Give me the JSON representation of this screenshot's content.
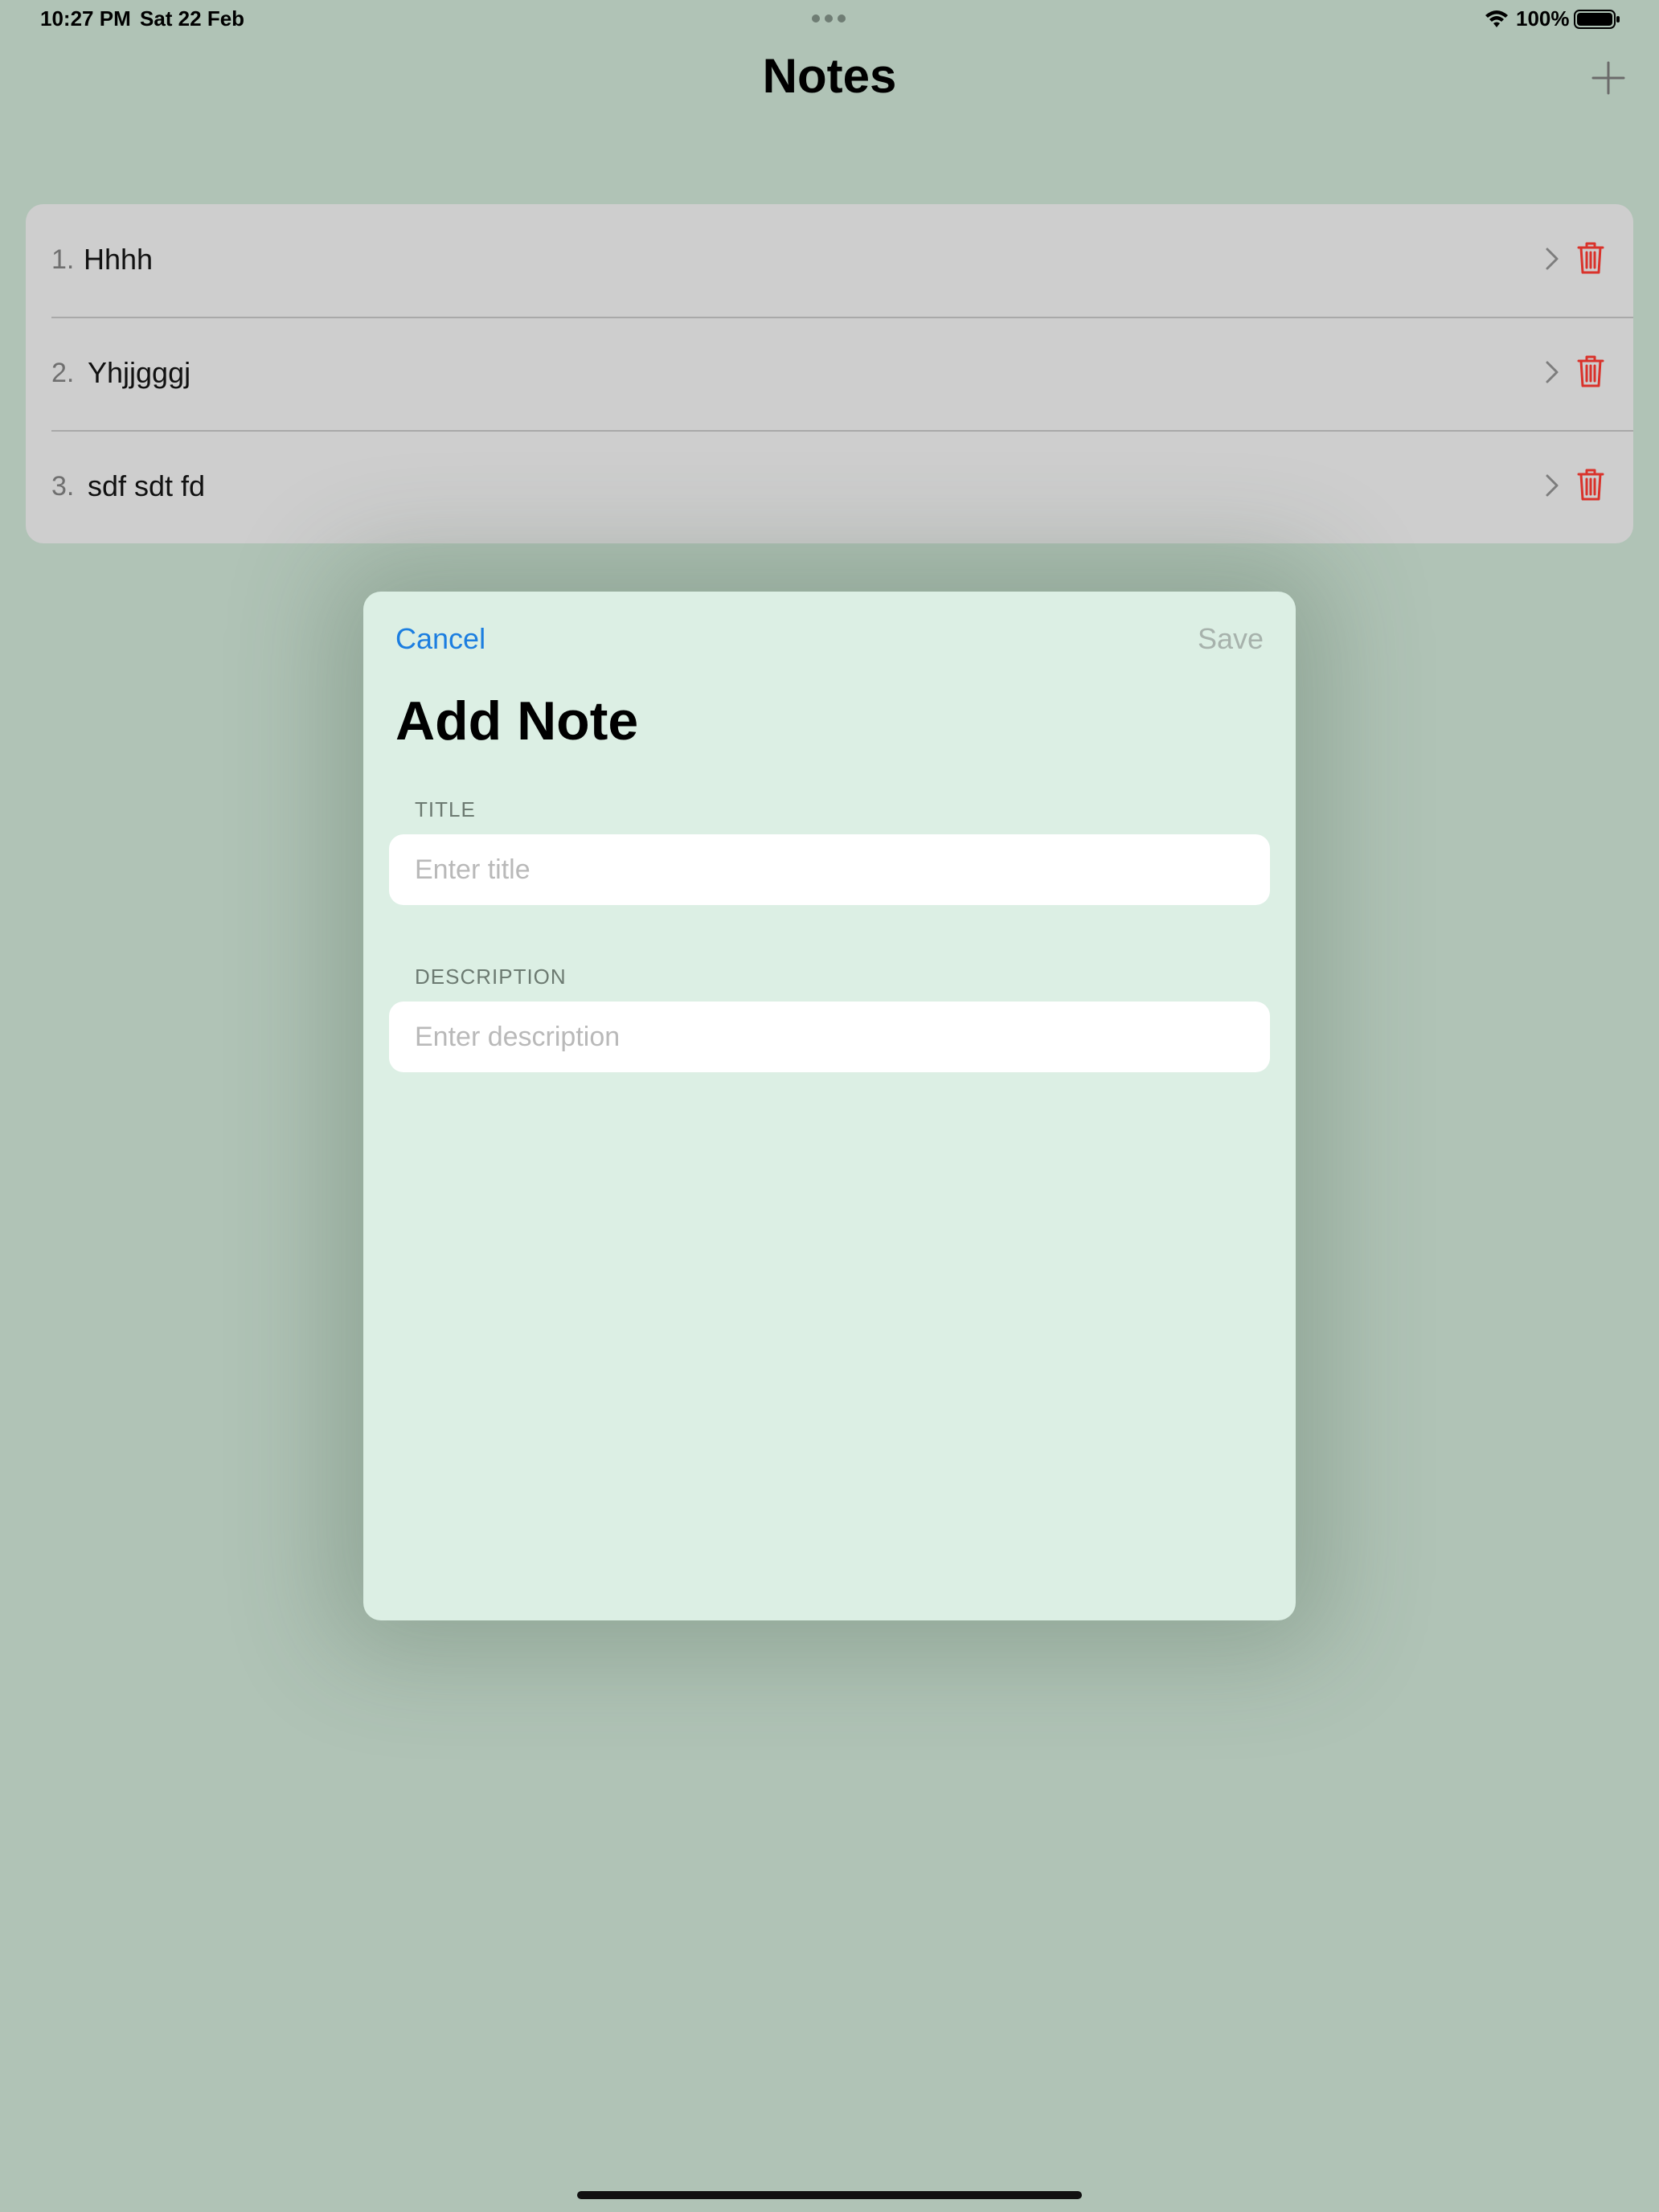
{
  "status_bar": {
    "time": "10:27 PM",
    "date": "Sat 22 Feb",
    "battery": "100%"
  },
  "nav": {
    "title": "Notes",
    "add_icon": "plus-icon"
  },
  "notes": [
    {
      "number": "1.",
      "title": "Hhhh"
    },
    {
      "number": "2.",
      "title": "Yhjjgggj"
    },
    {
      "number": "3.",
      "title": "sdf sdt fd"
    }
  ],
  "modal": {
    "cancel_label": "Cancel",
    "save_label": "Save",
    "title": "Add Note",
    "title_section_label": "TITLE",
    "title_placeholder": "Enter title",
    "title_value": "",
    "description_section_label": "DESCRIPTION",
    "description_placeholder": "Enter description",
    "description_value": ""
  },
  "colors": {
    "background": "#b0c3b6",
    "list_card": "#cecece",
    "modal_background": "#dcefe4",
    "accent": "#1c7ee0",
    "delete": "#d9322b",
    "disabled": "#a7b2ac"
  }
}
